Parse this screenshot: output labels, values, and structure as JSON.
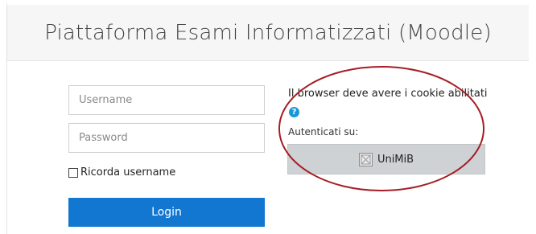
{
  "header": {
    "title": "Piattaforma Esami Informatizzati (Moodle)"
  },
  "login_form": {
    "username": {
      "value": "",
      "placeholder": "Username"
    },
    "password": {
      "value": "",
      "placeholder": "Password"
    },
    "remember_label": "Ricorda username",
    "remember_checked": false,
    "login_label": "Login"
  },
  "side_panel": {
    "cookie_text": "Il browser deve avere i cookie abilitati",
    "help_icon": "question-circle-icon",
    "auth_label": "Autenticati su:",
    "identity_provider": {
      "label": "UniMiB",
      "icon": "institution-logo-icon"
    }
  },
  "colors": {
    "primary": "#1177d1",
    "header_bg": "#f6f6f6",
    "idp_bg": "#cfd2d5",
    "help_icon": "#1b97d6",
    "annotation_circle": "#a51d24"
  }
}
